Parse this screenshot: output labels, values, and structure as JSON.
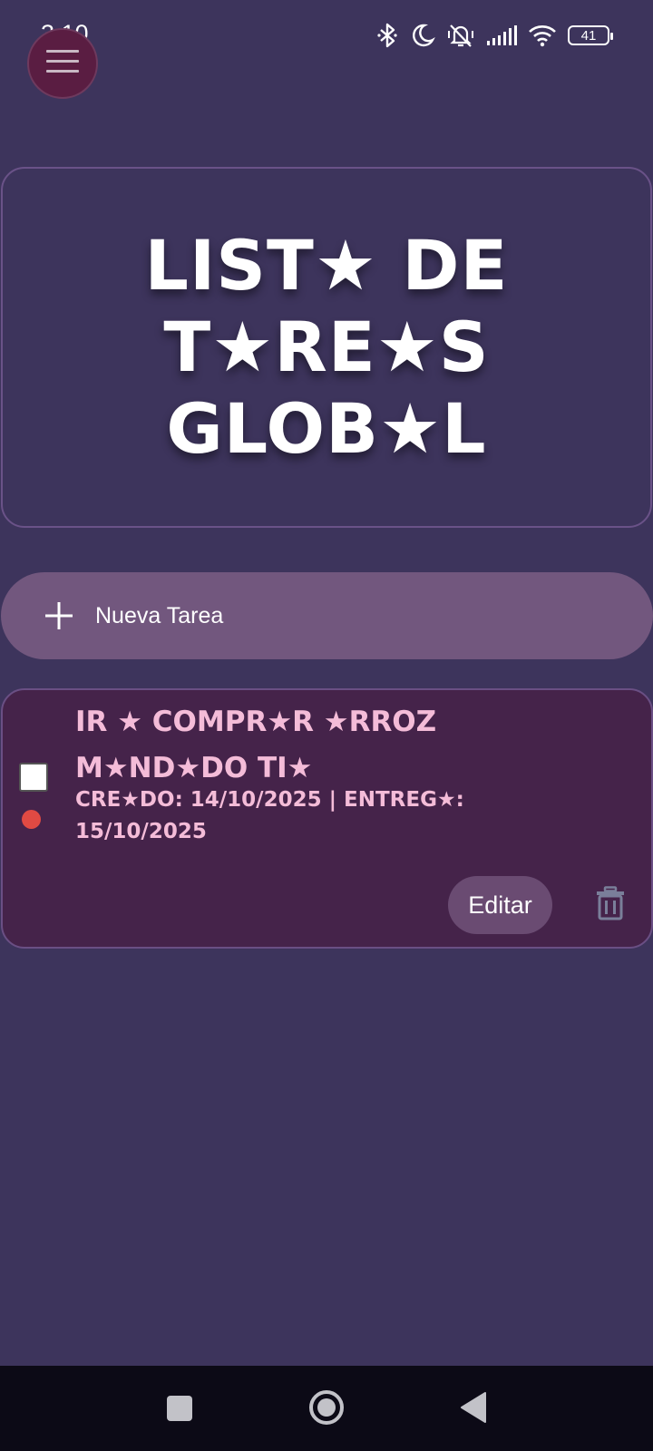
{
  "status_bar": {
    "time": "3:10",
    "battery": "41",
    "icons": [
      "bluetooth-icon",
      "do-not-disturb-icon",
      "vibrate-icon",
      "signal-icon",
      "wifi-icon",
      "battery-icon"
    ]
  },
  "header": {
    "menu_icon": "hamburger-menu-icon",
    "title": "LIST★ DE T★RE★S GLOB★L"
  },
  "new_task": {
    "icon": "plus-icon",
    "label": "Nueva Tarea"
  },
  "tasks": [
    {
      "title": "IR ★ COMPR★R ★RROZ M★ND★DO TI★",
      "dates": "CRE★DO: 14/10/2025 | ENTREG★: 15/10/2025",
      "checked": false,
      "priority_color": "#e04a43",
      "edit_label": "Editar",
      "delete_icon": "trash-icon"
    }
  ],
  "nav_bar": {
    "items": [
      "recents-icon",
      "home-icon",
      "back-icon"
    ]
  },
  "colors": {
    "background": "#3d345c",
    "task_card": "#45234a",
    "new_task_button": "#72577e",
    "task_text": "#f4bcd8",
    "menu_button": "#5a1d42"
  }
}
